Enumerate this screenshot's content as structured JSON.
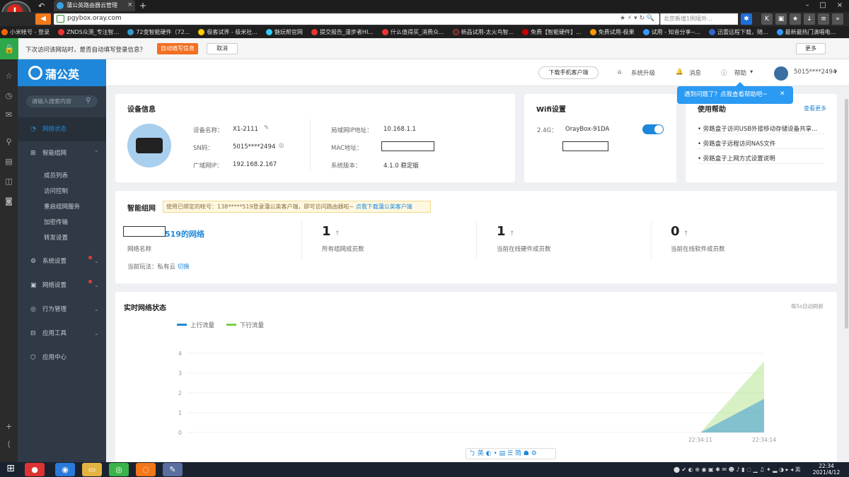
{
  "browser": {
    "tab_title": "蒲公英路由器云管理",
    "url": "pgybox.oray.com",
    "search_placeholder": "北京新增1例境外...",
    "bookmarks": [
      "小米帐号 - 登录",
      "ZNDS众测_专注智...",
      "72变智能硬件（72...",
      "极客试界 - 极米社...",
      "魅玩帮官网",
      "提交报告_漫步者HI...",
      "什么值得买_消费众...",
      "新品试用-太火鸟智...",
      "免费【智能硬件】...",
      "免费试用-极果",
      "试用 - 知音分享--...",
      "迅雷远程下载，随...",
      "最新最热门演唱电..."
    ],
    "password_bar": {
      "text": "下次访问该网站时，是否自动填写登录信息？",
      "auto_fill": "自动填写信息",
      "cancel": "取消",
      "more": "更多"
    }
  },
  "app": {
    "brand": "蒲公英",
    "search_placeholder": "请输入搜索内容",
    "nav": {
      "network_status": "网络状态",
      "smart_network": "智能组网",
      "sub": [
        "成员列表",
        "访问控制",
        "重启组网服务",
        "加密传输",
        "转发设置"
      ],
      "system_settings": "系统设置",
      "network_settings": "网络设置",
      "behavior": "行为管理",
      "tools": "应用工具",
      "app_center": "应用中心"
    },
    "topbar": {
      "download_client": "下载手机客户端",
      "upgrade": "系统升级",
      "messages": "消息",
      "help": "帮助",
      "account": "5015****2494"
    },
    "tooltip": "遇到问题了？点我查看帮助吧~"
  },
  "device": {
    "title": "设备信息",
    "name_label": "设备名称：",
    "name": "X1-2111",
    "sn_label": "SN码：",
    "sn": "5015****2494",
    "wan_label": "广域网IP：",
    "wan_ip": "192.168.2.167",
    "lan_label": "局域网IP地址：",
    "lan_ip": "10.168.1.1",
    "mac_label": "MAC地址：",
    "version_label": "系统版本：",
    "version": "4.1.0 稳定版"
  },
  "wifi": {
    "title": "Wifi设置",
    "band": "2.4G：",
    "ssid": "OrayBox-91DA"
  },
  "help": {
    "title": "使用帮助",
    "more": "查看更多",
    "items": [
      "旁路盒子访问USB外接移动存储设备共享...",
      "旁路盒子远程访问NAS文件",
      "旁路盒子上网方式设置说明"
    ]
  },
  "smart": {
    "title": "智能组网",
    "banner": "使用已绑定的帐号：138*****519登录蒲公英客户端，即可访问路由器啦~ ",
    "banner_link": "点我下载蒲公英客户端",
    "network_name_suffix": "519的网络",
    "network_name_label": "网络名称",
    "mode_label": "当前玩法：私有云",
    "mode_switch": "切换",
    "stats": [
      {
        "value": "1",
        "label": "所有组网成员数"
      },
      {
        "value": "1",
        "label": "当前在线硬件成员数"
      },
      {
        "value": "0",
        "label": "当前在线软件成员数"
      }
    ]
  },
  "realtime": {
    "title": "实时网络状态",
    "refresh": "每5s自动刷新",
    "legend_up": "上行流量",
    "legend_down": "下行流量"
  },
  "chart_data": {
    "type": "area",
    "x": [
      "",
      "22:34:11",
      "22:34:14"
    ],
    "y_ticks": [
      0,
      1,
      2,
      3,
      4
    ],
    "ylim": [
      0,
      4
    ],
    "series": [
      {
        "name": "上行流量",
        "color": "#1e87d9",
        "values": [
          0,
          0,
          1.7
        ]
      },
      {
        "name": "下行流量",
        "color": "#7ccf3f",
        "values": [
          0,
          0,
          3.6
        ]
      }
    ]
  },
  "ime": "英",
  "taskbar": {
    "time": "22:34",
    "date": "2021/4/12",
    "lang": "英"
  }
}
